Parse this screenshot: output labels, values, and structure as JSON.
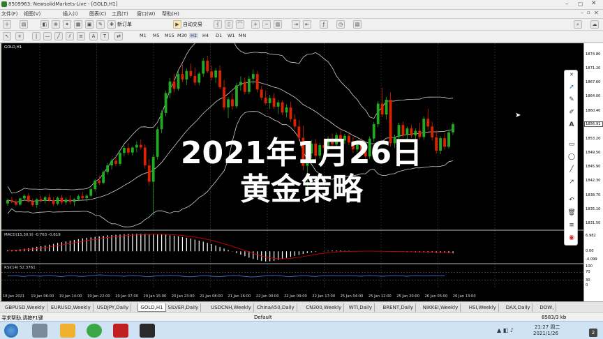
{
  "window": {
    "title": "8509963: NewsolidMarkets-Live - [GOLD,H1]"
  },
  "menu": [
    "文件(F)",
    "视图(V)",
    "插入(I)",
    "图表(C)",
    "工具(T)",
    "窗口(W)",
    "帮助(H)"
  ],
  "toolbar": {
    "new_order": "新订单",
    "auto_trading": "自动交易",
    "timeframes": [
      "M1",
      "M5",
      "M15",
      "M30",
      "H1",
      "H4",
      "D1",
      "W1",
      "MN"
    ]
  },
  "chart": {
    "symbol_label": "GOLD,H1",
    "macd_label": "MACD(15,30,9) -0.763 -0.619",
    "rsi_label": "RSI(14) 52.3761",
    "price_ticks": [
      "1874.80",
      "1871.20",
      "1867.60",
      "1864.00",
      "1860.40",
      "1853.20",
      "1849.50",
      "1845.90",
      "1842.30",
      "1838.70",
      "1835.10",
      "1831.50"
    ],
    "current_price": "1856.91",
    "macd_ticks": [
      "6.982",
      "0.00",
      "-4.099"
    ],
    "rsi_ticks": [
      "100",
      "70",
      "30",
      "0"
    ],
    "time_labels": [
      "18 Jan 2021",
      "19 Jan 06:00",
      "19 Jan 14:00",
      "19 Jan 22:00",
      "20 Jan 07:00",
      "20 Jan 15:00",
      "20 Jan 23:00",
      "21 Jan 08:00",
      "21 Jan 16:00",
      "22 Jan 00:00",
      "22 Jan 09:00",
      "22 Jan 17:00",
      "25 Jan 04:00",
      "25 Jan 12:00",
      "25 Jan 20:00",
      "26 Jan 05:00",
      "26 Jan 13:00"
    ],
    "colors": {
      "bull": "#22aa22",
      "bear": "#dd2200",
      "bands": "#cfcfcf",
      "macd": "#ffffff",
      "signal": "#cc0000",
      "rsi": "#3f6fd8"
    },
    "candles": [
      [
        1836.5,
        1837.8,
        1835.9,
        1837.4
      ],
      [
        1837.4,
        1838.2,
        1836.6,
        1836.9
      ],
      [
        1836.9,
        1837.6,
        1835.8,
        1836.2
      ],
      [
        1836.2,
        1838.0,
        1835.9,
        1837.8
      ],
      [
        1837.8,
        1838.9,
        1837.3,
        1838.5
      ],
      [
        1838.5,
        1839.2,
        1836.7,
        1837.0
      ],
      [
        1837.0,
        1837.8,
        1835.6,
        1836.1
      ],
      [
        1836.1,
        1837.9,
        1835.4,
        1837.6
      ],
      [
        1837.6,
        1838.5,
        1836.8,
        1837.2
      ],
      [
        1837.2,
        1838.4,
        1836.5,
        1838.1
      ],
      [
        1838.1,
        1839.0,
        1836.9,
        1837.3
      ],
      [
        1837.3,
        1838.1,
        1835.8,
        1836.4
      ],
      [
        1836.4,
        1838.3,
        1836.0,
        1838.0
      ],
      [
        1838.0,
        1838.7,
        1836.2,
        1836.8
      ],
      [
        1836.8,
        1838.0,
        1836.1,
        1837.5
      ],
      [
        1837.5,
        1838.6,
        1836.3,
        1836.9
      ],
      [
        1836.9,
        1837.9,
        1835.8,
        1837.6
      ],
      [
        1837.6,
        1838.8,
        1837.1,
        1838.4
      ],
      [
        1838.4,
        1839.5,
        1837.5,
        1837.9
      ],
      [
        1837.9,
        1838.9,
        1837.0,
        1838.5
      ],
      [
        1838.5,
        1840.6,
        1838.1,
        1840.2
      ],
      [
        1840.2,
        1842.8,
        1839.6,
        1842.4
      ],
      [
        1842.4,
        1843.6,
        1841.3,
        1841.8
      ],
      [
        1841.8,
        1845.0,
        1841.4,
        1844.6
      ],
      [
        1844.6,
        1846.9,
        1843.9,
        1846.3
      ],
      [
        1846.3,
        1848.1,
        1845.2,
        1847.5
      ],
      [
        1847.5,
        1848.8,
        1846.1,
        1846.7
      ],
      [
        1846.7,
        1849.9,
        1846.2,
        1849.5
      ],
      [
        1849.5,
        1851.4,
        1848.6,
        1850.8
      ],
      [
        1850.8,
        1852.0,
        1849.0,
        1849.6
      ],
      [
        1849.6,
        1851.2,
        1848.8,
        1850.9
      ],
      [
        1850.9,
        1852.5,
        1849.6,
        1851.6
      ],
      [
        1851.6,
        1853.0,
        1850.4,
        1850.9
      ],
      [
        1850.9,
        1851.8,
        1845.5,
        1846.3
      ],
      [
        1846.3,
        1848.0,
        1841.0,
        1842.1
      ],
      [
        1842.1,
        1849.2,
        1833.5,
        1848.5
      ],
      [
        1848.5,
        1856.2,
        1847.8,
        1855.6
      ],
      [
        1855.6,
        1860.5,
        1854.6,
        1859.8
      ],
      [
        1859.8,
        1865.5,
        1858.9,
        1864.9
      ],
      [
        1864.9,
        1868.8,
        1863.6,
        1867.9
      ],
      [
        1867.9,
        1869.8,
        1865.1,
        1866.0
      ],
      [
        1866.0,
        1870.7,
        1865.5,
        1869.8
      ],
      [
        1869.8,
        1872.3,
        1867.8,
        1868.4
      ],
      [
        1868.4,
        1871.2,
        1867.0,
        1870.6
      ],
      [
        1870.6,
        1872.5,
        1868.8,
        1869.3
      ],
      [
        1869.3,
        1871.5,
        1866.9,
        1867.6
      ],
      [
        1867.6,
        1870.4,
        1866.9,
        1869.9
      ],
      [
        1869.9,
        1873.9,
        1869.1,
        1873.2
      ],
      [
        1873.2,
        1874.5,
        1870.0,
        1870.5
      ],
      [
        1870.5,
        1872.0,
        1868.2,
        1868.9
      ],
      [
        1868.9,
        1871.3,
        1867.5,
        1870.7
      ],
      [
        1870.7,
        1872.0,
        1865.9,
        1866.4
      ],
      [
        1866.4,
        1868.3,
        1860.5,
        1861.2
      ],
      [
        1861.2,
        1863.9,
        1858.5,
        1863.3
      ],
      [
        1863.3,
        1864.8,
        1860.7,
        1861.5
      ],
      [
        1861.5,
        1867.5,
        1861.0,
        1866.9
      ],
      [
        1866.9,
        1869.2,
        1865.5,
        1867.8
      ],
      [
        1867.8,
        1868.9,
        1864.6,
        1865.2
      ],
      [
        1865.2,
        1869.3,
        1864.6,
        1868.6
      ],
      [
        1868.6,
        1871.0,
        1867.2,
        1869.8
      ],
      [
        1869.8,
        1870.6,
        1865.0,
        1865.8
      ],
      [
        1865.8,
        1866.8,
        1863.1,
        1863.7
      ],
      [
        1863.7,
        1865.6,
        1861.9,
        1862.3
      ],
      [
        1862.3,
        1864.4,
        1860.8,
        1863.6
      ],
      [
        1863.6,
        1864.9,
        1860.8,
        1861.4
      ],
      [
        1861.4,
        1863.1,
        1859.5,
        1862.5
      ],
      [
        1862.5,
        1863.0,
        1859.3,
        1859.9
      ],
      [
        1859.9,
        1862.0,
        1858.6,
        1861.2
      ],
      [
        1861.2,
        1862.7,
        1857.5,
        1858.2
      ],
      [
        1858.2,
        1859.5,
        1855.7,
        1856.3
      ],
      [
        1856.3,
        1858.0,
        1852.6,
        1853.4
      ],
      [
        1853.4,
        1856.5,
        1845.0,
        1846.2
      ],
      [
        1846.2,
        1850.3,
        1840.8,
        1849.4
      ],
      [
        1849.4,
        1852.8,
        1848.1,
        1851.9
      ],
      [
        1851.9,
        1853.1,
        1847.9,
        1848.8
      ],
      [
        1848.8,
        1852.1,
        1848.0,
        1851.5
      ],
      [
        1851.5,
        1853.0,
        1850.2,
        1850.8
      ],
      [
        1850.8,
        1853.8,
        1850.1,
        1853.2
      ],
      [
        1853.2,
        1854.5,
        1851.0,
        1851.7
      ],
      [
        1851.7,
        1854.7,
        1851.1,
        1854.1
      ],
      [
        1854.1,
        1855.2,
        1852.1,
        1852.7
      ],
      [
        1852.7,
        1854.4,
        1851.8,
        1853.9
      ],
      [
        1853.9,
        1854.8,
        1851.5,
        1852.2
      ],
      [
        1852.2,
        1853.7,
        1849.5,
        1850.4
      ],
      [
        1850.4,
        1852.9,
        1849.8,
        1852.2
      ],
      [
        1852.2,
        1853.3,
        1849.1,
        1849.8
      ],
      [
        1849.8,
        1852.0,
        1848.0,
        1848.6
      ],
      [
        1848.6,
        1853.8,
        1848.0,
        1853.2
      ],
      [
        1853.2,
        1857.5,
        1852.4,
        1856.9
      ],
      [
        1856.9,
        1862.8,
        1856.1,
        1862.2
      ],
      [
        1862.2,
        1866.3,
        1858.7,
        1859.4
      ],
      [
        1859.4,
        1863.9,
        1858.1,
        1863.2
      ],
      [
        1863.2,
        1865.1,
        1851.1,
        1852.0
      ],
      [
        1852.0,
        1854.2,
        1850.8,
        1853.6
      ],
      [
        1853.6,
        1857.3,
        1852.9,
        1856.7
      ],
      [
        1856.7,
        1857.6,
        1853.4,
        1854.1
      ],
      [
        1854.1,
        1856.3,
        1852.7,
        1855.8
      ],
      [
        1855.8,
        1856.8,
        1853.3,
        1854.0
      ],
      [
        1854.0,
        1855.8,
        1852.0,
        1855.2
      ],
      [
        1855.2,
        1857.3,
        1853.0,
        1853.6
      ],
      [
        1853.6,
        1858.9,
        1852.9,
        1858.3
      ],
      [
        1858.3,
        1860.9,
        1855.5,
        1856.3
      ],
      [
        1856.3,
        1857.5,
        1852.7,
        1853.5
      ],
      [
        1853.5,
        1855.2,
        1849.3,
        1850.1
      ],
      [
        1850.1,
        1853.8,
        1849.2,
        1853.3
      ],
      [
        1853.3,
        1854.6,
        1850.3,
        1851.1
      ],
      [
        1851.1,
        1855.4,
        1850.6,
        1854.8
      ],
      [
        1854.8,
        1857.4,
        1854.1,
        1856.9
      ]
    ],
    "macd": [
      0.4,
      0.5,
      0.6,
      0.8,
      1.0,
      1.2,
      1.5,
      1.8,
      2.0,
      2.3,
      2.6,
      2.9,
      3.3,
      3.6,
      3.9,
      4.2,
      4.5,
      4.8,
      5.1,
      5.3,
      5.5,
      5.7,
      5.9,
      6.1,
      6.3,
      6.4,
      6.5,
      6.6,
      6.7,
      6.8,
      6.8,
      6.9,
      6.9,
      6.9,
      6.8,
      6.8,
      6.7,
      6.6,
      6.5,
      6.3,
      6.1,
      5.9,
      5.6,
      5.3,
      5.0,
      4.6,
      4.2,
      3.8,
      3.3,
      2.8,
      2.3,
      1.7,
      1.1,
      0.5,
      -0.1,
      -0.7,
      -1.3,
      -1.9,
      -2.5,
      -3.0,
      -3.4,
      -3.8,
      -4.0,
      -3.9,
      -3.7,
      -3.4,
      -3.0,
      -2.6,
      -2.2,
      -1.8,
      -1.4,
      -1.0,
      -0.7,
      -0.4,
      -0.2,
      0.0,
      0.1,
      0.2,
      0.3,
      0.3,
      0.3,
      0.2,
      0.2,
      0.1,
      0.1,
      0.1,
      0.1,
      0.1,
      0.0,
      0.0,
      0.0,
      -0.1,
      -0.1,
      -0.2,
      -0.2,
      -0.2,
      -0.3,
      -0.3,
      -0.4,
      -0.4,
      -0.4,
      -0.5,
      -0.5,
      -0.6,
      -0.6,
      -0.6,
      -0.7,
      -0.8
    ],
    "rsi": [
      52,
      51,
      53,
      50,
      49,
      52,
      54,
      51,
      50,
      53,
      55,
      52,
      50,
      48,
      51,
      53,
      52,
      50,
      49,
      51,
      53,
      55,
      57,
      56,
      54,
      53,
      52,
      51,
      50,
      52,
      54,
      53,
      51,
      49,
      48,
      50,
      52,
      51,
      53,
      55,
      54,
      52,
      50,
      48,
      47,
      49,
      51,
      53,
      52,
      50,
      49,
      48,
      50,
      52,
      54,
      53,
      51,
      49,
      47,
      46,
      48,
      50,
      52,
      54,
      55,
      53,
      51,
      49,
      48,
      50,
      51,
      53,
      52,
      50,
      49,
      51,
      52,
      52,
      53,
      52,
      51,
      52,
      53,
      52,
      51,
      50,
      52,
      53,
      52,
      51,
      50,
      51,
      52,
      53,
      52,
      51,
      50,
      52,
      53,
      52,
      51,
      52,
      53,
      52,
      51,
      52
    ]
  },
  "overlay": {
    "line1": "2021年1月26日",
    "line2": "黄金策略"
  },
  "tabs": [
    "GBPUSD,Weekly",
    "EURUSD,Weekly",
    "USDJPY,Daily",
    "GOLD,H1",
    "SILVER,Daily",
    "USDCNH,Weekly",
    "ChinaA50,Daily",
    "CN300,Weekly",
    "WTI,Daily",
    "BRENT,Daily",
    "NIKKEI,Weekly",
    "HSI,Weekly",
    "DAX,Daily",
    "DOW,"
  ],
  "active_tab": 3,
  "status": {
    "help": "寻求帮助,请按F1键",
    "profile": "Default",
    "traffic": "8583/3 kb"
  },
  "taskbar": {
    "time": "21:27 周二",
    "date": "2021/1/26",
    "badge": "2"
  }
}
